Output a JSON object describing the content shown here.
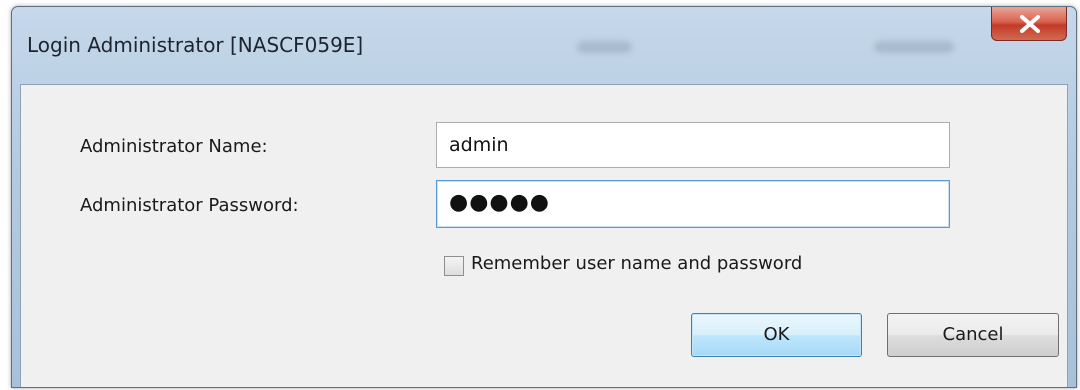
{
  "window": {
    "title": "Login Administrator [NASCF059E]",
    "close_icon": "close-x-icon"
  },
  "form": {
    "name_label": "Administrator Name:",
    "name_value": "admin",
    "password_label": "Administrator Password:",
    "password_masked": "●●●●●",
    "remember_label": "Remember user name and password",
    "remember_checked": false
  },
  "buttons": {
    "ok_label": "OK",
    "cancel_label": "Cancel"
  },
  "colors": {
    "title_bar": "#b4cbe2",
    "close_button": "#c23b27",
    "dialog_body": "#f0f0f0",
    "focus_border": "#5b9bd5"
  }
}
